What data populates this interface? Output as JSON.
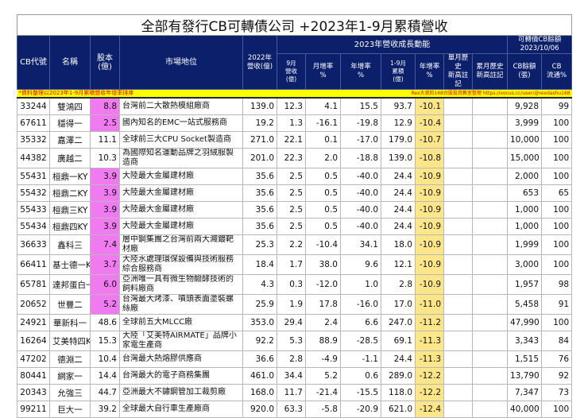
{
  "title": "全部有發行CB可轉債公司 +2023年1-9月累積營收",
  "headers": {
    "code": "CB代號",
    "name": "名稱",
    "capital": "股本\n(億)",
    "market": "市場地位",
    "rev2022": "2022年\n營收(億)",
    "group2023": "2023年營收成長動能",
    "groupCB": "可轉債CB餘額\n2023/10/06",
    "sep": "9月\n營收\n(億)",
    "mom": "月增率\n%",
    "yoy": "年增率\n%",
    "ytd": "1-9月\n累積\n(億)",
    "ytdyoy": "年增率\n%",
    "highM": "單月歷史\n新高註記",
    "highC": "累月歷史\n新高註記",
    "cbBal": "CB餘額\n(張)",
    "cbPct": "CB\n流通%"
  },
  "note_left": "*資料整理以2023年1-9月累積營收年增率排序",
  "note_right": "Rex大叔的168台股投資教室整理 https://vocus.cc/user/@rexdashu168",
  "colors": {
    "header": "#0b1f6a",
    "highlight_capital": "#f07af0",
    "highlight_yoy": "#fde68a",
    "note_bg": "#ffff00"
  },
  "rows": [
    {
      "code": "33244",
      "name": "雙鴻四",
      "capital": "8.8",
      "pink": true,
      "market": "台灣前二大散熱模組廠商",
      "rev2022": "139.0",
      "sep": "12.3",
      "mom": "4.1",
      "yoy": "15.5",
      "ytd": "93.7",
      "ytdyoy": "-10.1",
      "highM": "",
      "highC": "",
      "cbBal": "9,928",
      "cbPct": "99"
    },
    {
      "code": "67611",
      "name": "穩得一",
      "capital": "2.5",
      "pink": true,
      "market": "國內知名的EMC一站式服務商",
      "rev2022": "19.2",
      "sep": "1.3",
      "mom": "-16.1",
      "yoy": "-19.8",
      "ytd": "12.9",
      "ytdyoy": "-10.4",
      "highM": "",
      "highC": "",
      "cbBal": "3,999",
      "cbPct": "100"
    },
    {
      "code": "35332",
      "name": "嘉澤二",
      "capital": "11.1",
      "pink": false,
      "market": "全球前三大CPU Socket製造商",
      "rev2022": "271.0",
      "sep": "22.1",
      "mom": "0.1",
      "yoy": "-17.0",
      "ytd": "179.0",
      "ytdyoy": "-10.7",
      "highM": "",
      "highC": "",
      "cbBal": "10,000",
      "cbPct": "100"
    },
    {
      "code": "44382",
      "name": "廣越二",
      "capital": "10.3",
      "pink": false,
      "tall": true,
      "market": "為國際知名運動品牌之羽絨服製造商",
      "rev2022": "201.0",
      "sep": "22.3",
      "mom": "2.0",
      "yoy": "-18.8",
      "ytd": "139.0",
      "ytdyoy": "-10.8",
      "highM": "",
      "highC": "",
      "cbBal": "15,000",
      "cbPct": "100"
    },
    {
      "code": "55431",
      "name": "桓鼎一KY",
      "capital": "3.9",
      "pink": true,
      "market": "大陸最大金屬建材廠",
      "rev2022": "35.6",
      "sep": "2.5",
      "mom": "0.5",
      "yoy": "-40.0",
      "ytd": "24.4",
      "ytdyoy": "-10.9",
      "highM": "",
      "highC": "",
      "cbBal": "2,000",
      "cbPct": "100"
    },
    {
      "code": "55432",
      "name": "桓鼎二KY",
      "capital": "3.9",
      "pink": true,
      "market": "大陸最大金屬建材廠",
      "rev2022": "35.6",
      "sep": "2.5",
      "mom": "0.5",
      "yoy": "-40.0",
      "ytd": "24.4",
      "ytdyoy": "-10.9",
      "highM": "",
      "highC": "",
      "cbBal": "653",
      "cbPct": "65"
    },
    {
      "code": "55433",
      "name": "桓鼎三KY",
      "capital": "3.9",
      "pink": true,
      "market": "大陸最大金屬建材廠",
      "rev2022": "35.6",
      "sep": "2.5",
      "mom": "0.5",
      "yoy": "-40.0",
      "ytd": "24.4",
      "ytdyoy": "-10.9",
      "highM": "",
      "highC": "",
      "cbBal": "1,000",
      "cbPct": "100"
    },
    {
      "code": "55434",
      "name": "桓鼎四KY",
      "capital": "3.9",
      "pink": true,
      "market": "大陸最大金屬建材廠",
      "rev2022": "35.6",
      "sep": "2.5",
      "mom": "0.5",
      "yoy": "-40.0",
      "ytd": "24.4",
      "ytdyoy": "-10.9",
      "highM": "",
      "highC": "",
      "cbBal": "1,000",
      "cbPct": "100"
    },
    {
      "code": "36633",
      "name": "鑫科三",
      "capital": "7.4",
      "pink": true,
      "tall": true,
      "market": "層中鋼集團之台灣前兩大濺鍍靶材廠",
      "rev2022": "25.3",
      "sep": "2.2",
      "mom": "-10.4",
      "yoy": "34.1",
      "ytd": "18.0",
      "ytdyoy": "-10.9",
      "highM": "",
      "highC": "",
      "cbBal": "1,999",
      "cbPct": "100"
    },
    {
      "code": "66411",
      "name": "基士德一KY",
      "capital": "3.7",
      "pink": true,
      "tall": true,
      "market": "大陸水處理環保設備與技術服務綜合服務商",
      "rev2022": "18.4",
      "sep": "1.7",
      "mom": "38.0",
      "yoy": "9.6",
      "ytd": "12.1",
      "ytdyoy": "-10.9",
      "highM": "",
      "highC": "",
      "cbBal": "3,000",
      "cbPct": "100"
    },
    {
      "code": "65781",
      "name": "達邦蛋白一",
      "capital": "6.0",
      "pink": true,
      "tall": true,
      "market": "亞洲唯一具有微生物醱酵技術的飼料廠商",
      "rev2022": "4.3",
      "sep": "0.3",
      "mom": "-12.0",
      "yoy": "1.0",
      "ytd": "2.8",
      "ytdyoy": "-10.9",
      "highM": "",
      "highC": "",
      "cbBal": "1,957",
      "cbPct": "98"
    },
    {
      "code": "20652",
      "name": "世豐二",
      "capital": "5.2",
      "pink": true,
      "tall": true,
      "market": "台灣最大烤漆、噴頭表面塗裝螺絲廠",
      "rev2022": "25.9",
      "sep": "1.9",
      "mom": "17.8",
      "yoy": "-16.0",
      "ytd": "17.0",
      "ytdyoy": "-11.0",
      "highM": "",
      "highC": "",
      "cbBal": "5,458",
      "cbPct": "91"
    },
    {
      "code": "24921",
      "name": "華新科一",
      "capital": "48.6",
      "pink": false,
      "market": "全球前五大MLCC廠",
      "rev2022": "353.0",
      "sep": "29.4",
      "mom": "2.4",
      "yoy": "6.6",
      "ytd": "247.0",
      "ytdyoy": "-11.2",
      "highM": "",
      "highC": "",
      "cbBal": "47,990",
      "cbPct": "100"
    },
    {
      "code": "16264",
      "name": "艾美特四KY",
      "capital": "15.3",
      "pink": false,
      "tall": true,
      "market": "大陸「艾美特AIRMATE」品牌小家電生產商",
      "rev2022": "92.2",
      "sep": "5.3",
      "mom": "88.9",
      "yoy": "-28.5",
      "ytd": "69.1",
      "ytdyoy": "-11.3",
      "highM": "",
      "highC": "",
      "cbBal": "3,343",
      "cbPct": "84"
    },
    {
      "code": "47202",
      "name": "德淵二",
      "capital": "10.4",
      "pink": false,
      "market": "台灣最大熱熔膠供應商",
      "rev2022": "36.6",
      "sep": "2.8",
      "mom": "-4.9",
      "yoy": "-1.1",
      "ytd": "24.4",
      "ytdyoy": "-11.3",
      "highM": "",
      "highC": "",
      "cbBal": "1,515",
      "cbPct": "76"
    },
    {
      "code": "80441",
      "name": "網家一",
      "capital": "14.4",
      "pink": false,
      "market": "台灣最大的電子商務集團",
      "rev2022": "461.0",
      "sep": "34.4",
      "mom": "5.2",
      "yoy": "0.6",
      "ytd": "289.0",
      "ytdyoy": "-12.2",
      "highM": "",
      "highC": "",
      "cbBal": "13,790",
      "cbPct": "92"
    },
    {
      "code": "20343",
      "name": "允強三",
      "capital": "44.7",
      "pink": false,
      "market": "亞洲最大不鏽鋼管加工裁剪廠",
      "rev2022": "168.0",
      "sep": "11.7",
      "mom": "-21.4",
      "yoy": "-15.5",
      "ytd": "118.0",
      "ytdyoy": "-12.2",
      "highM": "",
      "highC": "",
      "cbBal": "7,347",
      "cbPct": "73"
    },
    {
      "code": "99211",
      "name": "巨大一",
      "capital": "39.2",
      "pink": false,
      "market": "全球最大自行車生產廠商",
      "rev2022": "920.0",
      "sep": "63.3",
      "mom": "-5.8",
      "yoy": "-20.9",
      "ytd": "621.0",
      "ytdyoy": "-12.4",
      "highM": "",
      "highC": "",
      "cbBal": "40,000",
      "cbPct": "100"
    }
  ]
}
